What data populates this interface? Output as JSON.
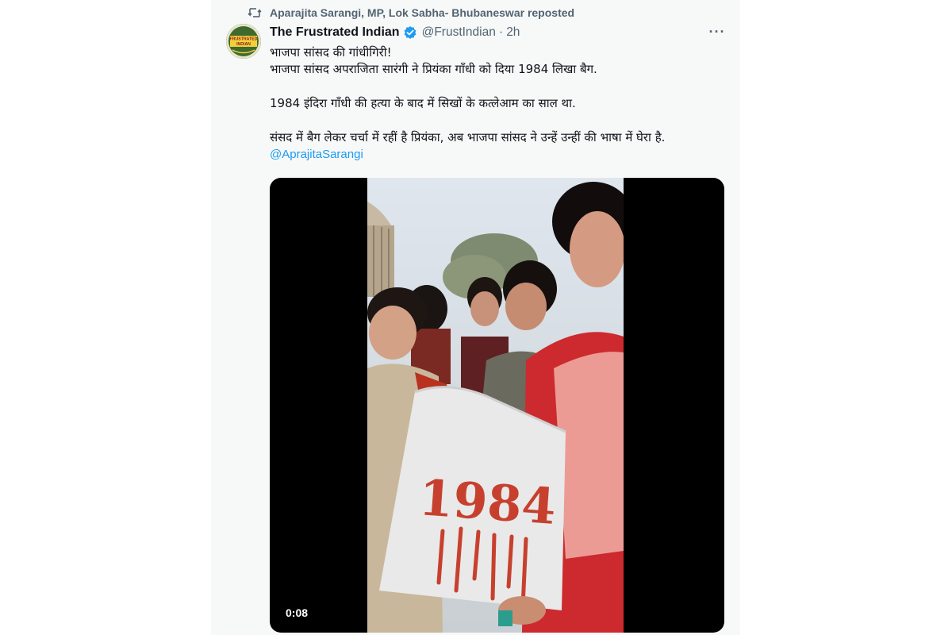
{
  "repost": {
    "text": "Aparajita Sarangi, MP, Lok Sabha- Bhubaneswar reposted",
    "icon": "repost-icon"
  },
  "author": {
    "display_name": "The Frustrated Indian",
    "handle": "@FrustIndian",
    "time": "2h",
    "separator": "·",
    "verified_icon": "verified-badge-icon",
    "avatar_text": "FRUSTRATED INDIAN"
  },
  "more_label": "···",
  "tweet": {
    "line1": "भाजपा सांसद की गांधीगिरी!",
    "line2": "भाजपा सांसद अपराजिता सारंगी ने प्रियंका गाँधी को दिया 1984 लिखा बैग.",
    "para2": "1984 इंदिरा गाँधी की हत्या के बाद में सिखों के कत्लेआम का साल था.",
    "para3": "संसद में बैग लेकर चर्चा में रहीं है प्रियंका, अब भाजपा सांसद ने उन्हें उन्हीं की भाषा में घेरा है.",
    "mention": "@AprajitaSarangi"
  },
  "video": {
    "timestamp": "0:08",
    "bag_text": "1984"
  },
  "colors": {
    "accent": "#1d9bf0",
    "text_primary": "#0f1419",
    "text_secondary": "#536471",
    "panel_bg": "#f7f9f9"
  }
}
